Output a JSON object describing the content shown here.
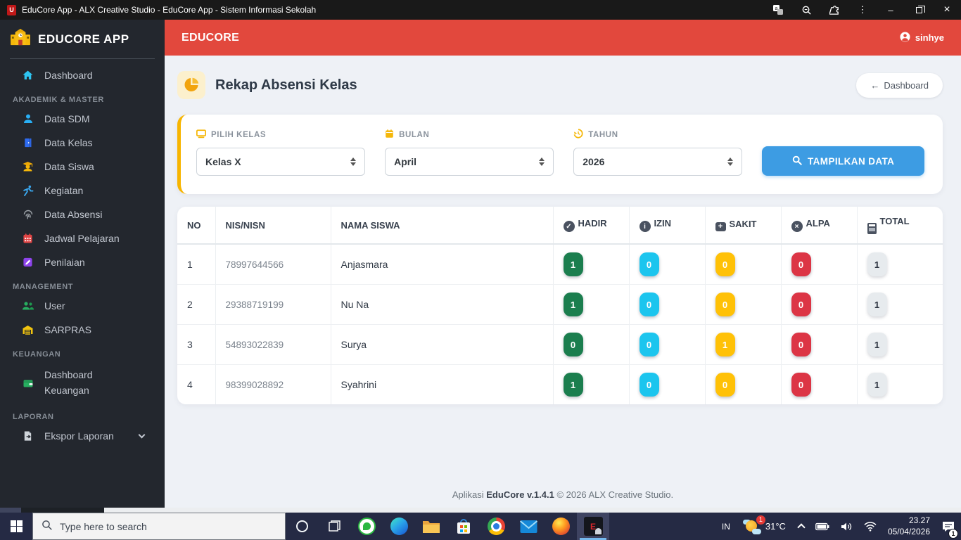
{
  "window": {
    "title": "EduCore App - ALX Creative Studio - EduCore App - Sistem Informasi Sekolah"
  },
  "sidebar": {
    "brand": "EDUCORE APP",
    "items": {
      "dashboard": "Dashboard",
      "section_akademik": "AKADEMIK & MASTER",
      "data_sdm": "Data SDM",
      "data_kelas": "Data Kelas",
      "data_siswa": "Data Siswa",
      "kegiatan": "Kegiatan",
      "data_absensi": "Data Absensi",
      "jadwal_pelajaran": "Jadwal Pelajaran",
      "penilaian": "Penilaian",
      "section_management": "MANAGEMENT",
      "user": "User",
      "sarpras": "SARPRAS",
      "section_keuangan": "KEUANGAN",
      "dashboard_keuangan": "Dashboard Keuangan",
      "section_laporan": "LAPORAN",
      "ekspor_laporan": "Ekspor Laporan"
    }
  },
  "topbar": {
    "brand": "EDUCORE",
    "user": "sinhye"
  },
  "page": {
    "title": "Rekap Absensi Kelas",
    "back_label": "Dashboard"
  },
  "filters": {
    "kelas_label": "PILIH KELAS",
    "kelas_value": "Kelas X",
    "bulan_label": "BULAN",
    "bulan_value": "April",
    "tahun_label": "TAHUN",
    "tahun_value": "2026",
    "submit_label": "TAMPILKAN DATA"
  },
  "table": {
    "columns": {
      "no": "NO",
      "nis": "NIS/NISN",
      "nama": "NAMA SISWA",
      "hadir": "HADIR",
      "izin": "IZIN",
      "sakit": "SAKIT",
      "alpa": "ALPA",
      "total": "TOTAL"
    },
    "rows": [
      {
        "no": "1",
        "nis": "78997644566",
        "nama": "Anjasmara",
        "hadir": "1",
        "izin": "0",
        "sakit": "0",
        "alpa": "0",
        "total": "1"
      },
      {
        "no": "2",
        "nis": "29388719199",
        "nama": "Nu Na",
        "hadir": "1",
        "izin": "0",
        "sakit": "0",
        "alpa": "0",
        "total": "1"
      },
      {
        "no": "3",
        "nis": "54893022839",
        "nama": "Surya",
        "hadir": "0",
        "izin": "0",
        "sakit": "1",
        "alpa": "0",
        "total": "1"
      },
      {
        "no": "4",
        "nis": "98399028892",
        "nama": "Syahrini",
        "hadir": "1",
        "izin": "0",
        "sakit": "0",
        "alpa": "0",
        "total": "1"
      }
    ]
  },
  "footer": {
    "prefix": "Aplikasi",
    "version": "EduCore v.1.4.1",
    "suffix": "© 2026 ALX Creative Studio."
  },
  "taskbar": {
    "search_placeholder": "Type here to search",
    "tray": {
      "lang": "IN",
      "temp": "31°C",
      "time": "23.27",
      "date": "05/04/2026",
      "weather_badge": "1",
      "notif_badge": "1"
    }
  },
  "icons": {
    "app_glyph": "U",
    "back_arrow": "←",
    "check": "✓",
    "info": "i",
    "cross": "×",
    "plus": "+",
    "kebab": "⋮",
    "minimize": "–",
    "close": "×"
  },
  "colors": {
    "accent_red": "#e2483d",
    "sidebar_bg": "#23272e",
    "button_blue": "#3d9ce3",
    "filter_yellow": "#f7b500",
    "badge_hadir": "#1b7e4e",
    "badge_izin": "#1cc5ee",
    "badge_sakit": "#ffc107",
    "badge_alpa": "#dc3545",
    "badge_total_bg": "#e7ebee",
    "taskbar_bg": "#252a44"
  }
}
